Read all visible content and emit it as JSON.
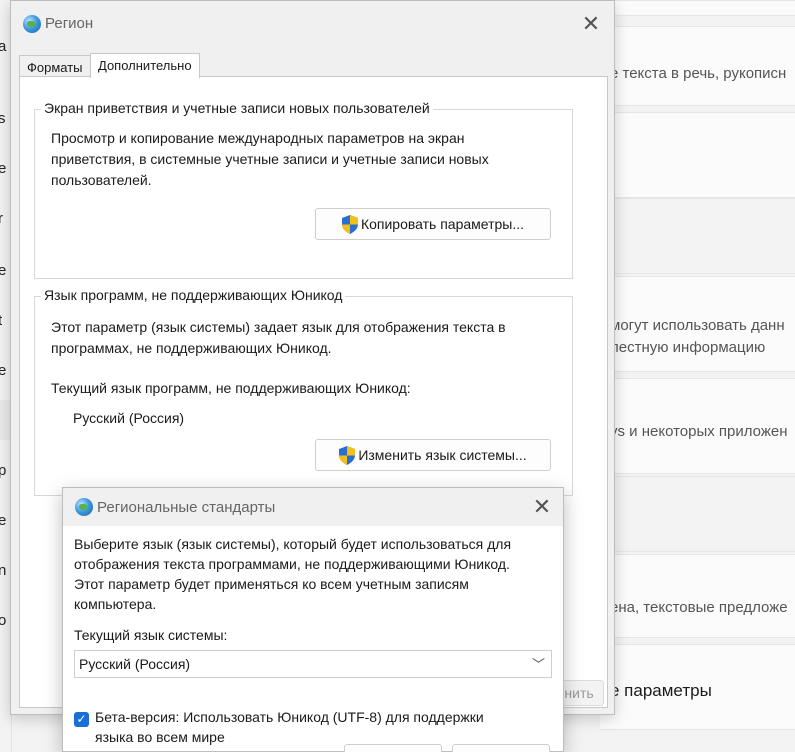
{
  "background": {
    "left_chars": [
      "a",
      "s",
      "e",
      "r",
      "e",
      "t",
      "e",
      "p",
      "e",
      "n",
      "o"
    ],
    "settings_lines": [
      "е текста в речь, рукописн",
      "могут использовать данн",
      "лестную информацию",
      "vs и некоторых приложен",
      "ена, текстовые предложе",
      "е параметры"
    ]
  },
  "region_dialog": {
    "title": "Регион",
    "close_glyph": "✕",
    "tabs": [
      "Форматы",
      "Дополнительно"
    ],
    "group1": {
      "title": "Экран приветствия и учетные записи новых пользователей",
      "desc_lines": [
        "Просмотр и копирование международных параметров на экран",
        "приветствия, в системные учетные записи и учетные записи новых",
        "пользователей."
      ],
      "button": "Копировать параметры..."
    },
    "group2": {
      "title": "Язык программ, не поддерживающих Юникод",
      "desc_lines": [
        "Этот параметр (язык системы) задает язык для отображения текста в",
        "программах, не поддерживающих Юникод."
      ],
      "current_label": "Текущий язык программ, не поддерживающих Юникод:",
      "current_value": "Русский (Россия)",
      "button": "Изменить язык системы..."
    },
    "partial_button": "менить"
  },
  "regional_dialog": {
    "title": "Региональные стандарты",
    "close_glyph": "✕",
    "desc_lines": [
      "Выберите язык (язык системы), который будет использоваться для",
      "отображения текста программами, не поддерживающими Юникод.",
      "Этот параметр будет применяться ко всем учетным записям",
      "компьютера."
    ],
    "current_label": "Текущий язык системы:",
    "select_value": "Русский (Россия)",
    "select_chevron": "﹀",
    "checkbox_mark": "✓",
    "checkbox_lines": [
      "Бета-версия: Использовать Юникод (UTF-8) для поддержки",
      "языка во всем мире"
    ]
  },
  "colors": {
    "accent": "#1a6fd6",
    "dialog_bg": "#f0f0f0",
    "panel_bg": "#ffffff"
  }
}
